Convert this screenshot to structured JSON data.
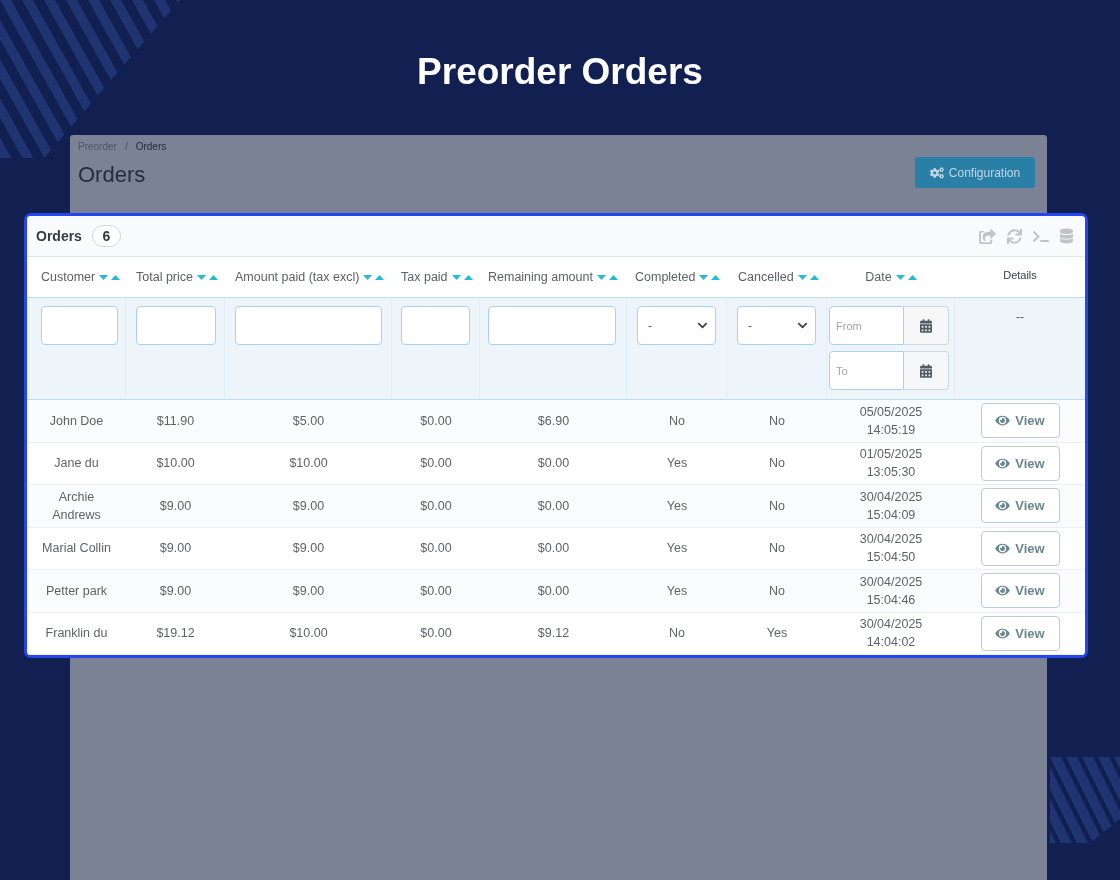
{
  "page": {
    "title": "Preorder Orders"
  },
  "backdrop": {
    "breadcrumb": {
      "separator": "/",
      "items": [
        {
          "label": "Preorder",
          "current": false
        },
        {
          "label": "Orders",
          "current": true
        }
      ]
    },
    "heading": "Orders",
    "button": "Configuration"
  },
  "panel": {
    "title": "Orders",
    "count": "6"
  },
  "columns": [
    {
      "label": "Customer",
      "sortable": true,
      "filter": {
        "kind": "text"
      }
    },
    {
      "label": "Total price",
      "sortable": true,
      "filter": {
        "kind": "text"
      }
    },
    {
      "label": "Amount paid (tax excl)",
      "sortable": true,
      "filter": {
        "kind": "text"
      }
    },
    {
      "label": "Tax paid",
      "sortable": true,
      "filter": {
        "kind": "text"
      }
    },
    {
      "label": "Remaining amount",
      "sortable": true,
      "filter": {
        "kind": "text"
      }
    },
    {
      "label": "Completed",
      "sortable": true,
      "filter": {
        "kind": "select",
        "value": "-"
      }
    },
    {
      "label": "Cancelled",
      "sortable": true,
      "filter": {
        "kind": "select",
        "value": "-"
      }
    },
    {
      "label": "Date",
      "sortable": true,
      "filter": {
        "kind": "date_range",
        "from": {
          "placeholder": "From"
        },
        "to": {
          "placeholder": "To"
        }
      }
    },
    {
      "label": "Details",
      "sortable": false,
      "filter": {
        "kind": "label",
        "text": "--"
      }
    }
  ],
  "rows": [
    {
      "cells": [
        "John Doe",
        "$11.90",
        "$5.00",
        "$0.00",
        "$6.90",
        "No",
        "No",
        "05/05/2025 14:05:19"
      ],
      "button": "View"
    },
    {
      "cells": [
        "Jane du",
        "$10.00",
        "$10.00",
        "$0.00",
        "$0.00",
        "Yes",
        "No",
        "01/05/2025 13:05:30"
      ],
      "button": "View"
    },
    {
      "cells": [
        "Archie Andrews",
        "$9.00",
        "$9.00",
        "$0.00",
        "$0.00",
        "Yes",
        "No",
        "30/04/2025 15:04:09"
      ],
      "button": "View"
    },
    {
      "cells": [
        "Marial Collin",
        "$9.00",
        "$9.00",
        "$0.00",
        "$0.00",
        "Yes",
        "No",
        "30/04/2025 15:04:50"
      ],
      "button": "View"
    },
    {
      "cells": [
        "Petter park",
        "$9.00",
        "$9.00",
        "$0.00",
        "$0.00",
        "Yes",
        "No",
        "30/04/2025 15:04:46"
      ],
      "button": "View"
    },
    {
      "cells": [
        "Franklin du",
        "$19.12",
        "$10.00",
        "$0.00",
        "$9.12",
        "No",
        "Yes",
        "30/04/2025 14:04:02"
      ],
      "button": "View"
    }
  ]
}
